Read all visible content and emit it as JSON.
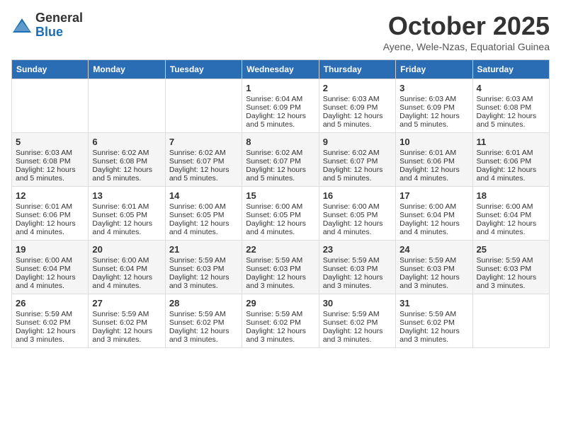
{
  "logo": {
    "general": "General",
    "blue": "Blue"
  },
  "header": {
    "month": "October 2025",
    "location": "Ayene, Wele-Nzas, Equatorial Guinea"
  },
  "weekdays": [
    "Sunday",
    "Monday",
    "Tuesday",
    "Wednesday",
    "Thursday",
    "Friday",
    "Saturday"
  ],
  "weeks": [
    [
      {
        "day": "",
        "lines": []
      },
      {
        "day": "",
        "lines": []
      },
      {
        "day": "",
        "lines": []
      },
      {
        "day": "1",
        "lines": [
          "Sunrise: 6:04 AM",
          "Sunset: 6:09 PM",
          "Daylight: 12 hours",
          "and 5 minutes."
        ]
      },
      {
        "day": "2",
        "lines": [
          "Sunrise: 6:03 AM",
          "Sunset: 6:09 PM",
          "Daylight: 12 hours",
          "and 5 minutes."
        ]
      },
      {
        "day": "3",
        "lines": [
          "Sunrise: 6:03 AM",
          "Sunset: 6:09 PM",
          "Daylight: 12 hours",
          "and 5 minutes."
        ]
      },
      {
        "day": "4",
        "lines": [
          "Sunrise: 6:03 AM",
          "Sunset: 6:08 PM",
          "Daylight: 12 hours",
          "and 5 minutes."
        ]
      }
    ],
    [
      {
        "day": "5",
        "lines": [
          "Sunrise: 6:03 AM",
          "Sunset: 6:08 PM",
          "Daylight: 12 hours",
          "and 5 minutes."
        ]
      },
      {
        "day": "6",
        "lines": [
          "Sunrise: 6:02 AM",
          "Sunset: 6:08 PM",
          "Daylight: 12 hours",
          "and 5 minutes."
        ]
      },
      {
        "day": "7",
        "lines": [
          "Sunrise: 6:02 AM",
          "Sunset: 6:07 PM",
          "Daylight: 12 hours",
          "and 5 minutes."
        ]
      },
      {
        "day": "8",
        "lines": [
          "Sunrise: 6:02 AM",
          "Sunset: 6:07 PM",
          "Daylight: 12 hours",
          "and 5 minutes."
        ]
      },
      {
        "day": "9",
        "lines": [
          "Sunrise: 6:02 AM",
          "Sunset: 6:07 PM",
          "Daylight: 12 hours",
          "and 5 minutes."
        ]
      },
      {
        "day": "10",
        "lines": [
          "Sunrise: 6:01 AM",
          "Sunset: 6:06 PM",
          "Daylight: 12 hours",
          "and 4 minutes."
        ]
      },
      {
        "day": "11",
        "lines": [
          "Sunrise: 6:01 AM",
          "Sunset: 6:06 PM",
          "Daylight: 12 hours",
          "and 4 minutes."
        ]
      }
    ],
    [
      {
        "day": "12",
        "lines": [
          "Sunrise: 6:01 AM",
          "Sunset: 6:06 PM",
          "Daylight: 12 hours",
          "and 4 minutes."
        ]
      },
      {
        "day": "13",
        "lines": [
          "Sunrise: 6:01 AM",
          "Sunset: 6:05 PM",
          "Daylight: 12 hours",
          "and 4 minutes."
        ]
      },
      {
        "day": "14",
        "lines": [
          "Sunrise: 6:00 AM",
          "Sunset: 6:05 PM",
          "Daylight: 12 hours",
          "and 4 minutes."
        ]
      },
      {
        "day": "15",
        "lines": [
          "Sunrise: 6:00 AM",
          "Sunset: 6:05 PM",
          "Daylight: 12 hours",
          "and 4 minutes."
        ]
      },
      {
        "day": "16",
        "lines": [
          "Sunrise: 6:00 AM",
          "Sunset: 6:05 PM",
          "Daylight: 12 hours",
          "and 4 minutes."
        ]
      },
      {
        "day": "17",
        "lines": [
          "Sunrise: 6:00 AM",
          "Sunset: 6:04 PM",
          "Daylight: 12 hours",
          "and 4 minutes."
        ]
      },
      {
        "day": "18",
        "lines": [
          "Sunrise: 6:00 AM",
          "Sunset: 6:04 PM",
          "Daylight: 12 hours",
          "and 4 minutes."
        ]
      }
    ],
    [
      {
        "day": "19",
        "lines": [
          "Sunrise: 6:00 AM",
          "Sunset: 6:04 PM",
          "Daylight: 12 hours",
          "and 4 minutes."
        ]
      },
      {
        "day": "20",
        "lines": [
          "Sunrise: 6:00 AM",
          "Sunset: 6:04 PM",
          "Daylight: 12 hours",
          "and 4 minutes."
        ]
      },
      {
        "day": "21",
        "lines": [
          "Sunrise: 5:59 AM",
          "Sunset: 6:03 PM",
          "Daylight: 12 hours",
          "and 3 minutes."
        ]
      },
      {
        "day": "22",
        "lines": [
          "Sunrise: 5:59 AM",
          "Sunset: 6:03 PM",
          "Daylight: 12 hours",
          "and 3 minutes."
        ]
      },
      {
        "day": "23",
        "lines": [
          "Sunrise: 5:59 AM",
          "Sunset: 6:03 PM",
          "Daylight: 12 hours",
          "and 3 minutes."
        ]
      },
      {
        "day": "24",
        "lines": [
          "Sunrise: 5:59 AM",
          "Sunset: 6:03 PM",
          "Daylight: 12 hours",
          "and 3 minutes."
        ]
      },
      {
        "day": "25",
        "lines": [
          "Sunrise: 5:59 AM",
          "Sunset: 6:03 PM",
          "Daylight: 12 hours",
          "and 3 minutes."
        ]
      }
    ],
    [
      {
        "day": "26",
        "lines": [
          "Sunrise: 5:59 AM",
          "Sunset: 6:02 PM",
          "Daylight: 12 hours",
          "and 3 minutes."
        ]
      },
      {
        "day": "27",
        "lines": [
          "Sunrise: 5:59 AM",
          "Sunset: 6:02 PM",
          "Daylight: 12 hours",
          "and 3 minutes."
        ]
      },
      {
        "day": "28",
        "lines": [
          "Sunrise: 5:59 AM",
          "Sunset: 6:02 PM",
          "Daylight: 12 hours",
          "and 3 minutes."
        ]
      },
      {
        "day": "29",
        "lines": [
          "Sunrise: 5:59 AM",
          "Sunset: 6:02 PM",
          "Daylight: 12 hours",
          "and 3 minutes."
        ]
      },
      {
        "day": "30",
        "lines": [
          "Sunrise: 5:59 AM",
          "Sunset: 6:02 PM",
          "Daylight: 12 hours",
          "and 3 minutes."
        ]
      },
      {
        "day": "31",
        "lines": [
          "Sunrise: 5:59 AM",
          "Sunset: 6:02 PM",
          "Daylight: 12 hours",
          "and 3 minutes."
        ]
      },
      {
        "day": "",
        "lines": []
      }
    ]
  ]
}
